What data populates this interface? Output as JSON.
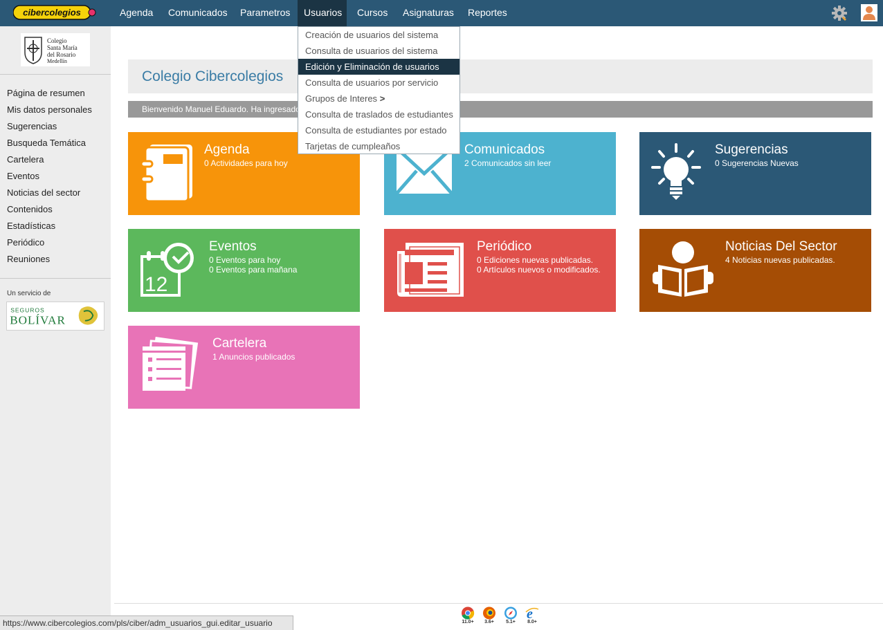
{
  "header": {
    "logo_text": "cibercolegios",
    "nav": [
      "Agenda",
      "Comunicados",
      "Parametros",
      "Usuarios",
      "Cursos",
      "Asignaturas",
      "Reportes"
    ],
    "active_nav": "Usuarios"
  },
  "dropdown": {
    "items": [
      "Creación de usuarios del sistema",
      "Consulta de usuarios del sistema",
      "Edición y Eliminación de usuarios",
      "Consulta de usuarios por servicio",
      "Grupos de Interes",
      "Consulta de traslados de estudiantes",
      "Consulta de estudiantes por estado",
      "Tarjetas de cumpleaños"
    ],
    "submenu_arrow": ">",
    "highlighted": "Edición y Eliminación de usuarios"
  },
  "sidebar": {
    "school_logo_text": [
      "Colegio",
      "Santa María",
      "del Rosario",
      "Medellín"
    ],
    "items": [
      "Página de resumen",
      "Mis datos personales",
      "Sugerencias",
      "Busqueda Temática",
      "Cartelera",
      "Eventos",
      "Noticias del sector",
      "Contenidos",
      "Estadísticas",
      "Periódico",
      "Reuniones"
    ],
    "service_label": "Un servicio de",
    "sponsor_line1": "SEGUROS",
    "sponsor_line2": "BOLÍVAR"
  },
  "main": {
    "school_title": "Colegio Cibercolegios",
    "welcome": "Bienvenido Manuel Eduardo. Ha ingresado",
    "tiles": [
      {
        "title": "Agenda",
        "lines": [
          "0 Actividades para hoy"
        ],
        "color": "#f7940a",
        "icon": "notebook-icon"
      },
      {
        "title": "Comunicados",
        "lines": [
          "2 Comunicados sin leer"
        ],
        "color": "#4db2cf",
        "icon": "envelope-icon"
      },
      {
        "title": "Sugerencias",
        "lines": [
          "0 Sugerencias Nuevas"
        ],
        "color": "#2b5876",
        "icon": "lightbulb-icon"
      },
      {
        "title": "Eventos",
        "lines": [
          "0 Eventos para hoy",
          "0 Eventos para mañana"
        ],
        "color": "#5cb85c",
        "icon": "calendar-clock-icon",
        "calendar_number": "12"
      },
      {
        "title": "Periódico",
        "lines": [
          "0 Ediciones nuevas publicadas.",
          "0 Artículos nuevos o modificados."
        ],
        "color": "#e0504b",
        "icon": "newspaper-icon"
      },
      {
        "title": "Noticias Del Sector",
        "lines": [
          "4 Noticias nuevas publicadas."
        ],
        "color": "#a54d05",
        "icon": "reader-icon"
      },
      {
        "title": "Cartelera",
        "lines": [
          "1 Anuncios publicados"
        ],
        "color": "#e873b7",
        "icon": "papers-icon"
      }
    ]
  },
  "footer": {
    "browsers": [
      {
        "name": "chrome",
        "version": "11.0+"
      },
      {
        "name": "firefox",
        "version": "3.6+"
      },
      {
        "name": "safari",
        "version": "5.1+"
      },
      {
        "name": "ie",
        "version": "8.0+"
      }
    ],
    "status_url": "https://www.cibercolegios.com/pls/ciber/adm_usuarios_gui.editar_usuario"
  }
}
